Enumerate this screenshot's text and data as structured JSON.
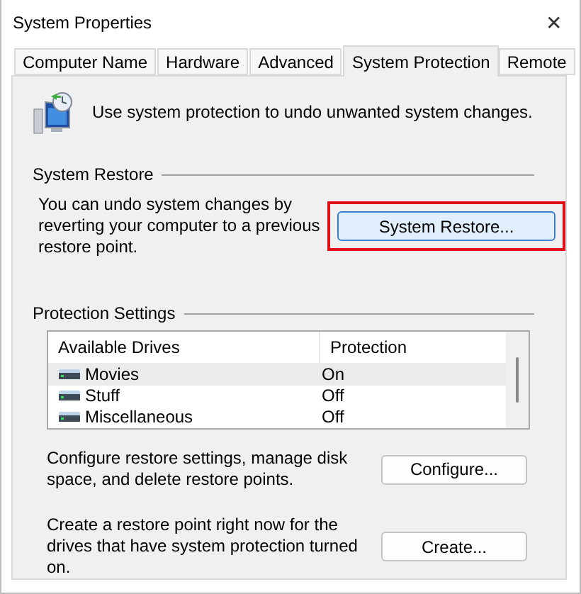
{
  "window": {
    "title": "System Properties",
    "close": "✕"
  },
  "tabs": [
    {
      "label": "Computer Name",
      "selected": false
    },
    {
      "label": "Hardware",
      "selected": false
    },
    {
      "label": "Advanced",
      "selected": false
    },
    {
      "label": "System Protection",
      "selected": true
    },
    {
      "label": "Remote",
      "selected": false
    }
  ],
  "intro": "Use system protection to undo unwanted system changes.",
  "system_restore": {
    "heading": "System Restore",
    "text": "You can undo system changes by reverting your computer to a previous restore point.",
    "button": {
      "label": "System Restore...",
      "highlighted": true
    }
  },
  "protection_settings": {
    "heading": "Protection Settings",
    "columns": [
      "Available Drives",
      "Protection"
    ],
    "rows": [
      {
        "drive": "Movies",
        "protection": "On",
        "selected": true
      },
      {
        "drive": "Stuff",
        "protection": "Off",
        "selected": false
      },
      {
        "drive": "Miscellaneous",
        "protection": "Off",
        "selected": false
      }
    ],
    "actions": [
      {
        "text": "Configure restore settings, manage disk space, and delete restore points.",
        "button": "Configure..."
      },
      {
        "text": "Create a restore point right now for the drives that have system protection turned on.",
        "button": "Create..."
      }
    ]
  }
}
